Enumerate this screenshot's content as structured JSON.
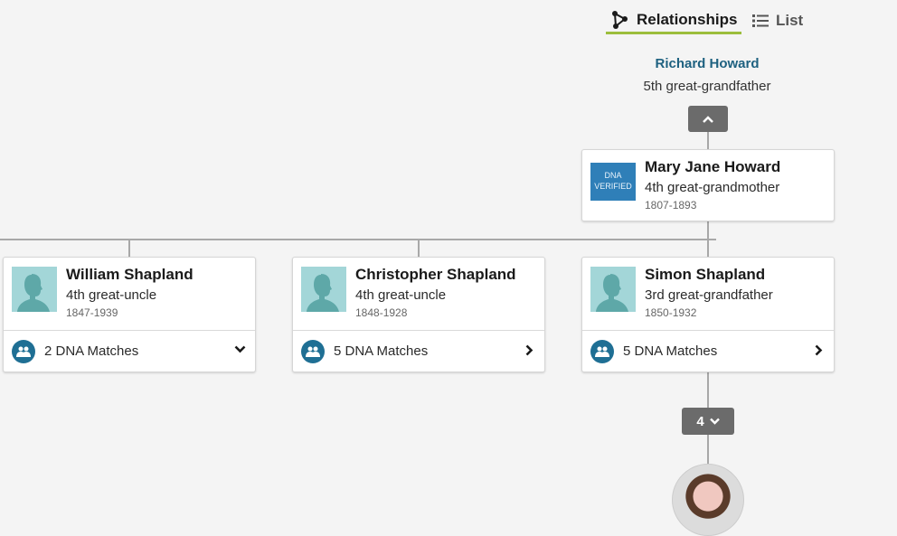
{
  "tabs": [
    {
      "label": "Relationships",
      "icon": "relationships-graph-icon",
      "active": true
    },
    {
      "label": "List",
      "icon": "list-icon",
      "active": false
    }
  ],
  "ancestor_top": {
    "name": "Richard Howard",
    "relationship": "5th great-grandfather"
  },
  "expand_up_button": {
    "icon": "chevron-up-icon"
  },
  "mother_card": {
    "name": "Mary Jane Howard",
    "relationship": "4th great-grandmother",
    "dates": "1807-1893",
    "badge": {
      "line1": "DNA",
      "line2": "VERIFIED"
    }
  },
  "children": [
    {
      "name": "William Shapland",
      "relationship": "4th great-uncle",
      "dates": "1847-1939",
      "dna_matches": "2 DNA Matches",
      "chevron": "down"
    },
    {
      "name": "Christopher Shapland",
      "relationship": "4th great-uncle",
      "dates": "1848-1928",
      "dna_matches": "5 DNA Matches",
      "chevron": "right"
    },
    {
      "name": "Simon Shapland",
      "relationship": "3rd great-grandfather",
      "dates": "1850-1932",
      "dna_matches": "5 DNA Matches",
      "chevron": "right"
    }
  ],
  "generations_button": {
    "count": "4",
    "icon": "chevron-down-icon"
  },
  "colors": {
    "accent": "#9cbe3c",
    "link": "#1e6180",
    "dna_icon": "#1f6f94",
    "button": "#6b6b6b"
  }
}
